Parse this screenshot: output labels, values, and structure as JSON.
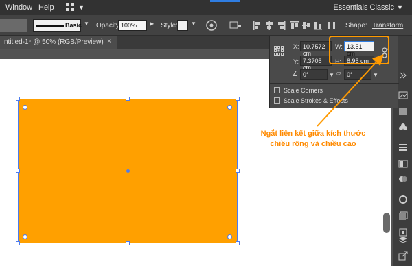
{
  "menubar": {
    "window": "Window",
    "help": "Help",
    "workspace": "Essentials Classic"
  },
  "controlbar": {
    "stroke_label": "Basic",
    "opacity_label": "Opacity:",
    "opacity_value": "100%",
    "style_label": "Style:",
    "shape_label": "Shape:",
    "transform_label": "Transform"
  },
  "tab": {
    "title": "ntitled-1* @ 50% (RGB/Preview)",
    "close": "×"
  },
  "transform": {
    "x_label": "X:",
    "x_value": "10.7572 cm",
    "y_label": "Y:",
    "y_value": "7.3705 cm",
    "w_label": "W:",
    "w_value": "13.51 cm",
    "h_label": "H:",
    "h_value": "8.95 cm",
    "angle_value": "0°",
    "shear_value": "0°",
    "scale_corners": "Scale Corners",
    "scale_strokes": "Scale Strokes & Effects"
  },
  "annotation": {
    "line1": "Ngắt liên kết giữa kích thước",
    "line2": "chiều rộng và chiều cao"
  },
  "colors": {
    "rect_fill": "#FFA000",
    "accent_orange": "#ff9a00",
    "selection_blue": "#4d7cf0"
  }
}
